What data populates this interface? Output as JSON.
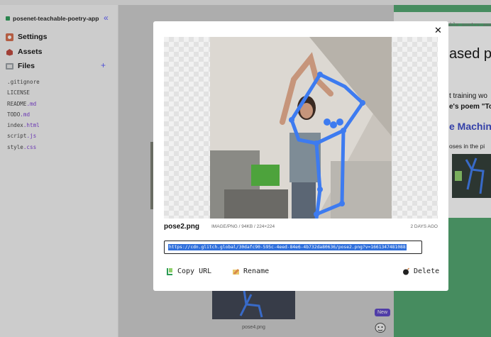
{
  "sidebar": {
    "project_name": "posenet-teachable-poetry-app",
    "collapse_icon": "«",
    "nav": [
      {
        "label": "Settings",
        "icon": "settings-icon"
      },
      {
        "label": "Assets",
        "icon": "assets-icon"
      },
      {
        "label": "Files",
        "icon": "files-icon"
      }
    ],
    "add_file_icon": "+",
    "files": [
      {
        "base": ".gitignore",
        "ext": ""
      },
      {
        "base": "LICENSE",
        "ext": ""
      },
      {
        "base": "README",
        "ext": ".md"
      },
      {
        "base": "TODO",
        "ext": ".md"
      },
      {
        "base": "index",
        "ext": ".html"
      },
      {
        "base": "script",
        "ext": ".js"
      },
      {
        "base": "style",
        "ext": ".css"
      }
    ]
  },
  "background": {
    "bottom_caption": "pose4.png",
    "new_badge": "New"
  },
  "preview_panel": {
    "url": "posenet-teachable-poetry-app",
    "title": "ased po",
    "line1": "t training wo",
    "line2": "e's poem \"To",
    "link": "e Machin",
    "line3": "oses in the pi"
  },
  "modal": {
    "close_icon": "✕",
    "filename": "pose2.png",
    "meta": "IMAGE/PNG / 94KB / 224×224",
    "date": "2 DAYS AGO",
    "url": "https://cdn.glitch.global/30dafc90-595c-4eed-84e6-4b732da80636/pose2.png?v=1661347481088",
    "actions": {
      "copy": "Copy URL",
      "rename": "Rename",
      "delete": "Delete"
    }
  },
  "colors": {
    "accent": "#5a5bff",
    "selection": "#2f6fdb",
    "glitch_green": "#4ea56d",
    "pose_skeleton": "#3d7bf0"
  }
}
